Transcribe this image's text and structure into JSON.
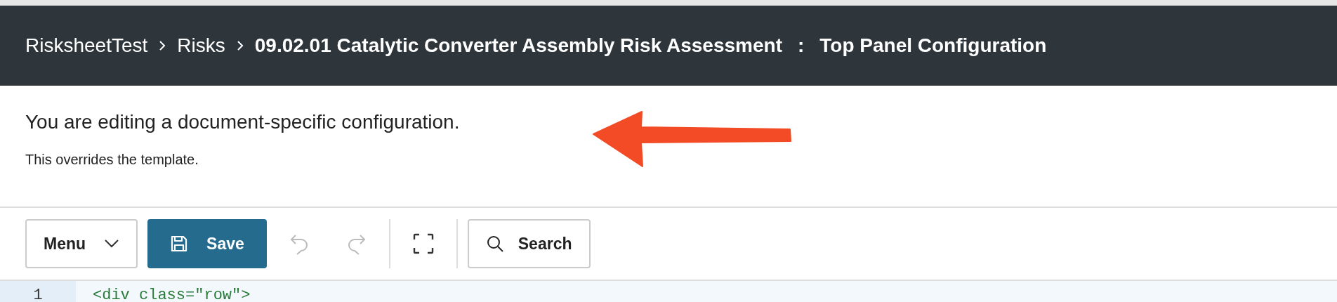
{
  "breadcrumb": {
    "items": [
      {
        "label": "RisksheetTest",
        "current": false
      },
      {
        "label": "Risks",
        "current": false
      },
      {
        "label": "09.02.01 Catalytic Converter Assembly Risk Assessment",
        "current": true
      }
    ],
    "separator": ":",
    "page_title": "Top Panel Configuration"
  },
  "notice": {
    "message": "You are editing a document-specific configuration.",
    "detail": "This overrides the template."
  },
  "toolbar": [
    {
      "kind": "dropdown",
      "label": "Menu"
    },
    {
      "kind": "primary",
      "label": "Save"
    },
    {
      "kind": "undo",
      "disabled": true
    },
    {
      "kind": "redo",
      "disabled": true
    },
    {
      "kind": "divider"
    },
    {
      "kind": "fullscreen",
      "disabled": false
    },
    {
      "kind": "divider"
    },
    {
      "kind": "search",
      "label": "Search"
    }
  ],
  "editor": {
    "lines": [
      {
        "number": "1",
        "text": "<div class=\"row\">"
      }
    ]
  }
}
